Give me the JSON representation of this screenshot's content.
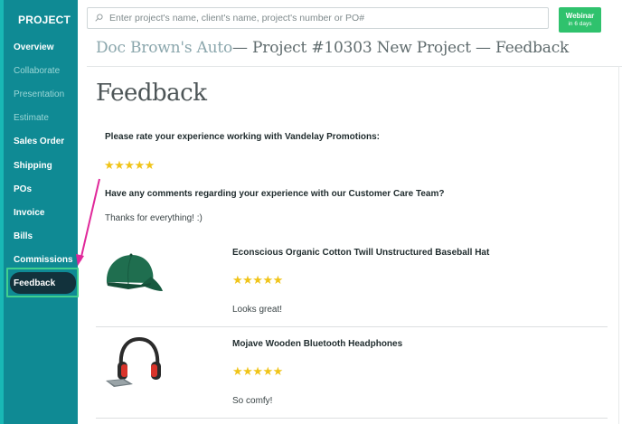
{
  "sidebar": {
    "title": "PROJECT",
    "items": [
      {
        "label": "Overview",
        "state": "normal"
      },
      {
        "label": "Collaborate",
        "state": "dim"
      },
      {
        "label": "Presentation",
        "state": "dim"
      },
      {
        "label": "Estimate",
        "state": "dim"
      },
      {
        "label": "Sales Order",
        "state": "normal"
      },
      {
        "label": "Shipping",
        "state": "normal"
      },
      {
        "label": "POs",
        "state": "normal"
      },
      {
        "label": "Invoice",
        "state": "normal"
      },
      {
        "label": "Bills",
        "state": "normal"
      },
      {
        "label": "Commissions",
        "state": "normal"
      },
      {
        "label": "Feedback",
        "state": "active"
      }
    ]
  },
  "header": {
    "search_placeholder": "Enter project's name, client's name, project's number or PO#",
    "webinar_label": "Webinar",
    "webinar_sub": "in 6 days",
    "breadcrumb_client": "Doc Brown's Auto",
    "breadcrumb_rest": "— Project #10303 New Project — Feedback"
  },
  "main": {
    "title": "Feedback",
    "rating_question": "Please rate your experience working with Vandelay Promotions:",
    "rating_stars": "★★★★★",
    "comments_question": "Have any comments regarding your experience with our Customer Care Team?",
    "comments_answer": "Thanks for everything! :)",
    "products": [
      {
        "name": "Econscious Organic Cotton Twill Unstructured Baseball Hat",
        "stars": "★★★★★",
        "comment": "Looks great!",
        "icon": "baseball-hat"
      },
      {
        "name": "Mojave Wooden Bluetooth Headphones",
        "stars": "★★★★★",
        "comment": "So comfy!",
        "icon": "headphones"
      }
    ]
  },
  "colors": {
    "sidebar_bg": "#0f8a94",
    "accent_green": "#2fc26d",
    "highlight_border": "#3fd08e",
    "star": "#f0c419",
    "arrow": "#e0289a"
  }
}
